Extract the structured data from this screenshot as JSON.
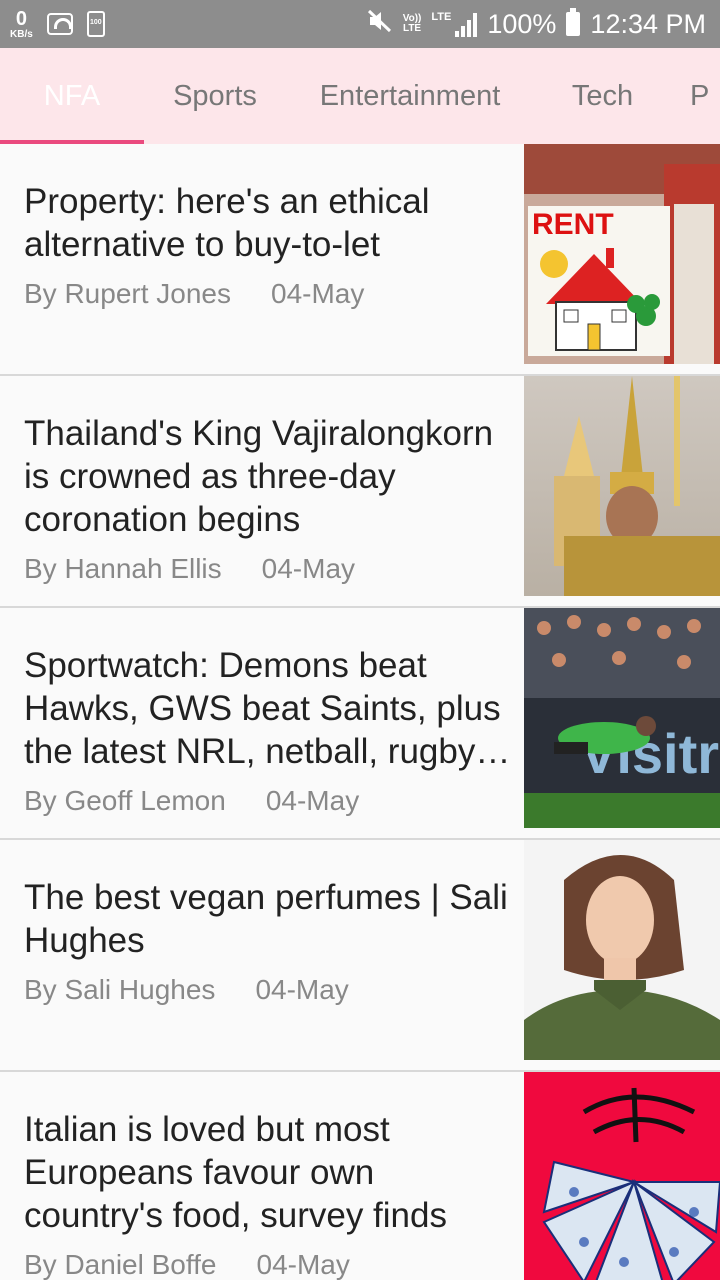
{
  "status_bar": {
    "data_rate_value": "0",
    "data_rate_unit": "KB/s",
    "small_battery_label": "100",
    "volte_label_top": "Vo))",
    "volte_label_bottom": "LTE",
    "network_label": "LTE",
    "battery_percent": "100%",
    "time": "12:34 PM"
  },
  "tabs": [
    {
      "label": "NFA",
      "active": true
    },
    {
      "label": "Sports",
      "active": false
    },
    {
      "label": "Entertainment",
      "active": false
    },
    {
      "label": "Tech",
      "active": false
    },
    {
      "label": "P",
      "active": false
    }
  ],
  "articles": [
    {
      "headline": "Property: here's an ethical alternative to buy-to-let",
      "author": "By Rupert Jones",
      "date": "04-May",
      "image": "rent-house-illustration",
      "image_text": "RENT"
    },
    {
      "headline": "Thailand's King Vajiralongkorn is crowned as three-day coronation begins",
      "author": "By Hannah Ellis",
      "date": "04-May",
      "image": "king-coronation-photo"
    },
    {
      "headline": "Sportwatch: Demons beat Hawks, GWS beat Saints, plus the latest NRL, netball, rugby…",
      "author": "By Geoff Lemon",
      "date": "04-May",
      "image": "rugby-try-photo",
      "image_text": "Visitr"
    },
    {
      "headline": "The best vegan perfumes | Sali Hughes",
      "author": "By Sali Hughes",
      "date": "04-May",
      "image": "woman-portrait-photo"
    },
    {
      "headline": "Italian is loved but most Europeans favour own country's food, survey finds",
      "author": "By Daniel Boffe",
      "date": "04-May",
      "image": "pizza-illustration"
    }
  ],
  "colors": {
    "tab_bar_bg": "#fde6ea",
    "tab_indicator": "#ea4a7e",
    "status_bar_bg": "#8d8d8d"
  }
}
